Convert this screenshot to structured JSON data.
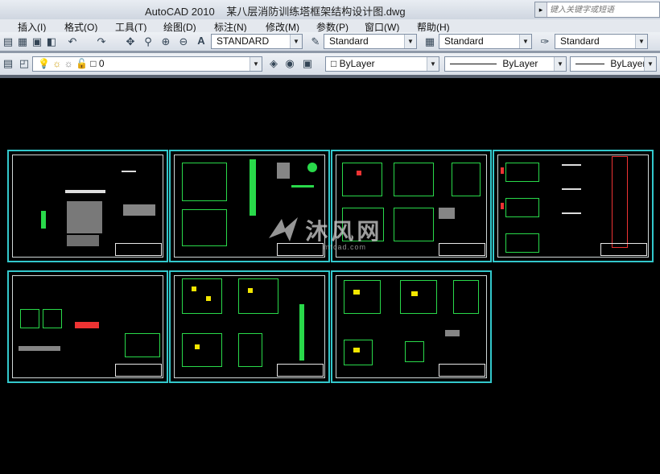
{
  "window": {
    "app_name": "AutoCAD 2010",
    "file_name": "某八层消防训练塔框架结构设计图.dwg",
    "search_placeholder": "键入关键字或短语"
  },
  "menu": [
    "插入(I)",
    "格式(O)",
    "工具(T)",
    "绘图(D)",
    "标注(N)",
    "修改(M)",
    "参数(P)",
    "窗口(W)",
    "帮助(H)"
  ],
  "styles_toolbar": {
    "text_style": "STANDARD",
    "dim_style": "Standard",
    "table_style": "Standard",
    "multileader_style": "Standard"
  },
  "layers_toolbar": {
    "current_layer": "0",
    "color": "ByLayer",
    "linetype": "ByLayer",
    "lineweight": "ByLayer"
  },
  "watermark": {
    "text": "沐风网",
    "url": "mfcad.com"
  },
  "colors": {
    "canvas": "#000000",
    "sheet_border": "#33c8cc",
    "grid_lines": "#29d94a",
    "highlight": "#f2e600"
  }
}
